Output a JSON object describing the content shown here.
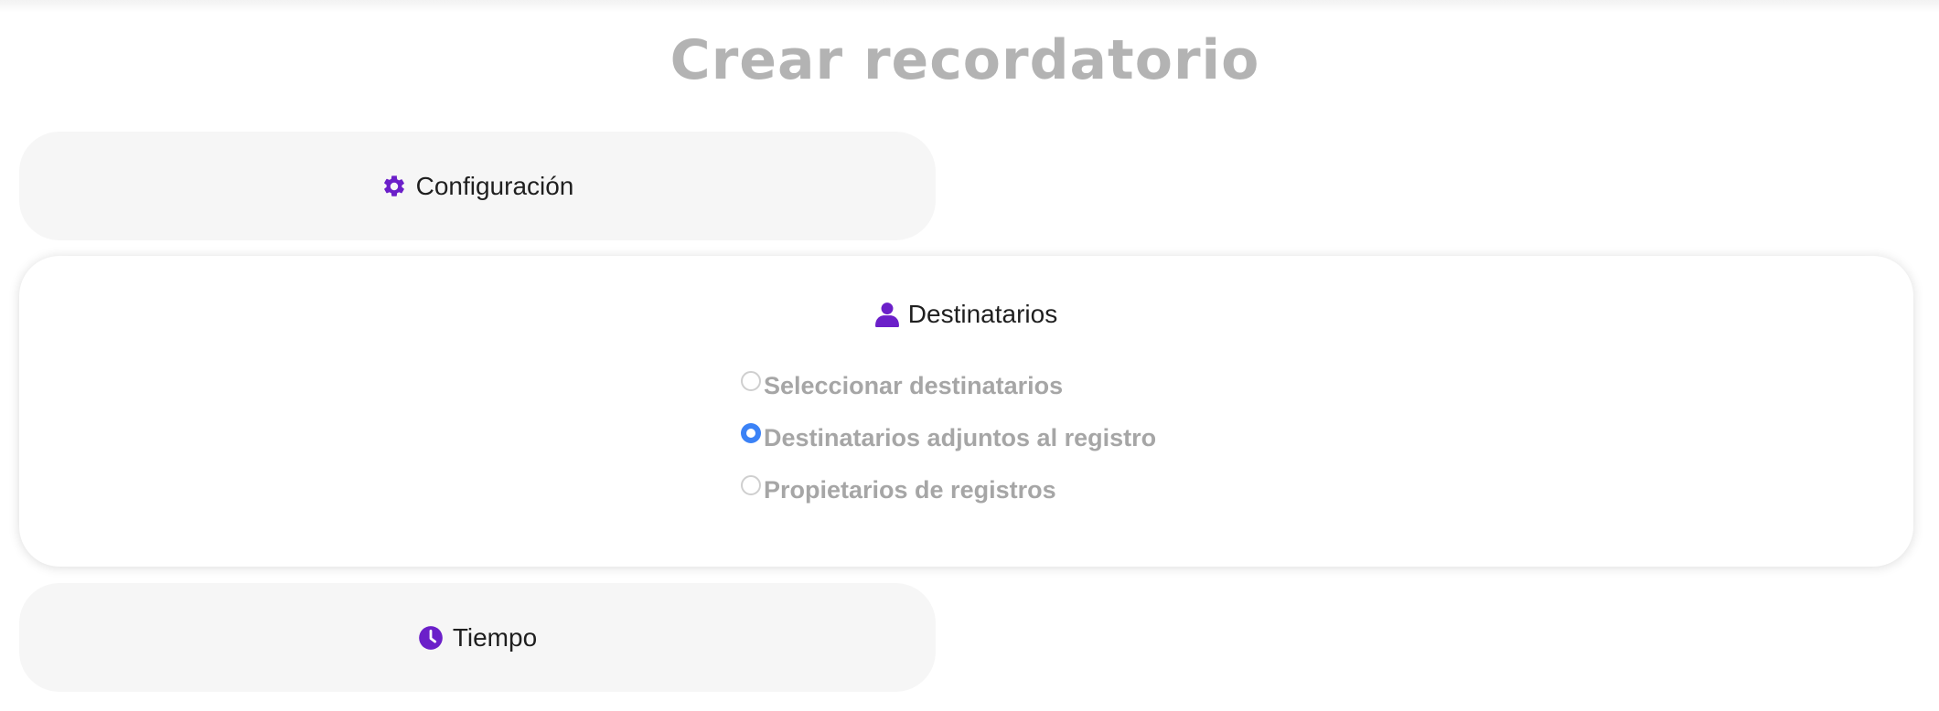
{
  "page": {
    "title": "Crear recordatorio"
  },
  "sections": {
    "configuracion": {
      "label": "Configuración",
      "icon": "gear-icon",
      "expanded": false
    },
    "destinatarios": {
      "label": "Destinatarios",
      "icon": "user-icon",
      "expanded": true,
      "options": [
        {
          "label": "Seleccionar destinatarios",
          "checked": false
        },
        {
          "label": "Destinatarios adjuntos al registro",
          "checked": true
        },
        {
          "label": "Propietarios de registros",
          "checked": false
        }
      ]
    },
    "tiempo": {
      "label": "Tiempo",
      "icon": "clock-icon",
      "expanded": false
    }
  },
  "colors": {
    "accent_icon": "#6b1fc9",
    "radio_selected": "#3b82f6",
    "title": "#b3b3b3",
    "option_text": "#a6a6a6",
    "collapsed_card_bg": "#f6f6f6"
  }
}
